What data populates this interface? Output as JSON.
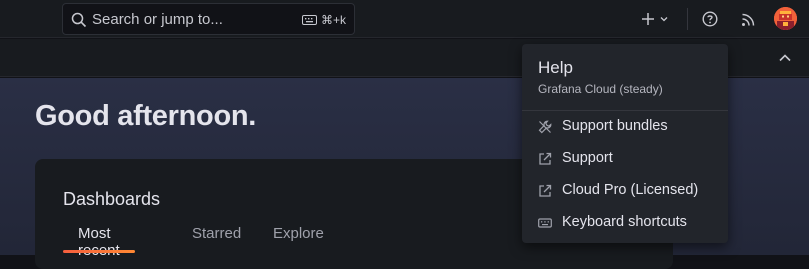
{
  "topbar": {
    "search_placeholder": "Search or jump to...",
    "search_shortcut": "⌘+k",
    "new_icon": "plus-icon",
    "help_icon": "help-icon",
    "news_icon": "rss-icon",
    "avatar_icon": "user-avatar"
  },
  "main": {
    "greeting": "Good afternoon.",
    "card_title": "Dashboards",
    "tabs": [
      {
        "label": "Most recent",
        "active": true
      },
      {
        "label": "Starred",
        "active": false
      },
      {
        "label": "Explore",
        "active": false
      }
    ]
  },
  "help_menu": {
    "title": "Help",
    "subtitle": "Grafana Cloud (steady)",
    "items": [
      {
        "label": "Support bundles",
        "icon": "wrench-icon"
      },
      {
        "label": "Support",
        "icon": "external-link-icon"
      },
      {
        "label": "Cloud Pro (Licensed)",
        "icon": "external-link-icon"
      },
      {
        "label": "Keyboard shortcuts",
        "icon": "keyboard-icon"
      }
    ]
  },
  "colors": {
    "accent": "#f55f3e",
    "background": "#111217",
    "panel": "#181b1f",
    "menu": "#22252b"
  }
}
